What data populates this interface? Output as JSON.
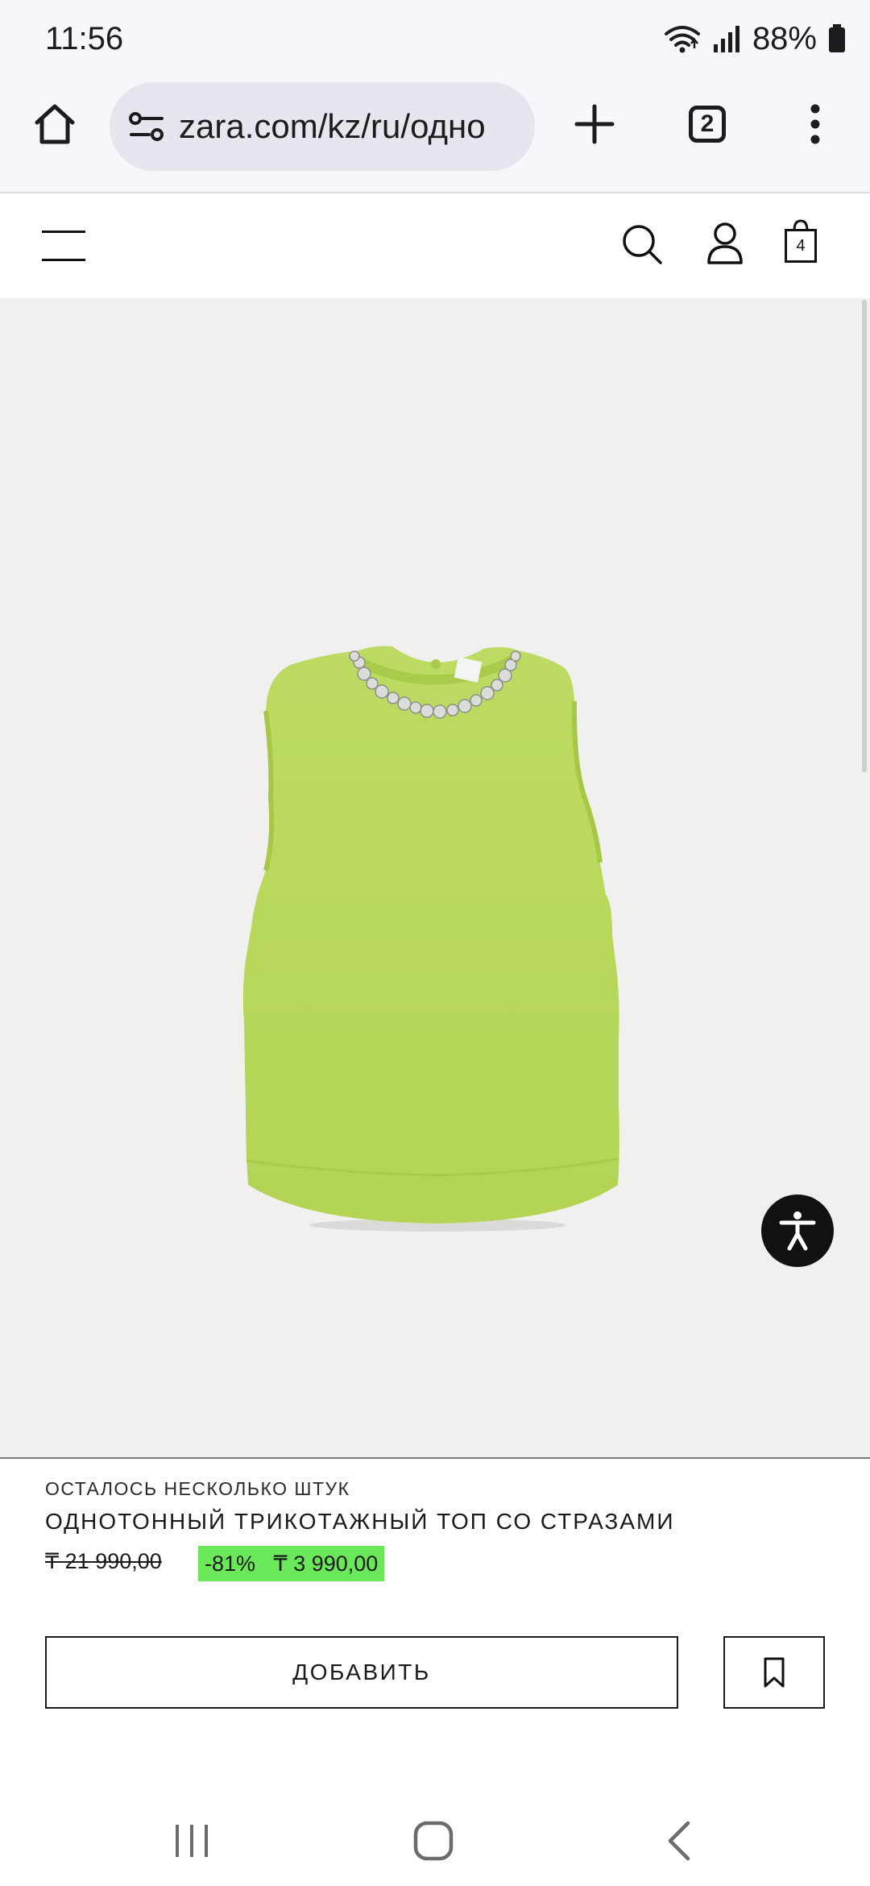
{
  "status_bar": {
    "time": "11:56",
    "battery_percent": "88%",
    "icons": [
      "wifi-icon",
      "signal-icon",
      "battery-icon"
    ]
  },
  "browser": {
    "url": "zara.com/kz/ru/одно",
    "tab_count": "2",
    "icons": [
      "home-icon",
      "site-settings-icon",
      "plus-icon",
      "tabs-icon",
      "more-vert-icon"
    ]
  },
  "site_header": {
    "bag_count": "4",
    "icons": [
      "hamburger-menu-icon",
      "search-icon",
      "account-icon",
      "shopping-bag-icon"
    ]
  },
  "product": {
    "image_subject": "lime sleeveless knit top",
    "stock_note": "ОСТАЛОСЬ НЕСКОЛЬКО ШТУК",
    "title": "ОДНОТОННЫЙ ТРИКОТАЖНЫЙ ТОП СО СТРАЗАМИ",
    "old_price": "₸ 21 990,00",
    "discount": "-81%",
    "new_price": "₸ 3 990,00",
    "sale_color": "#6be85a",
    "garment_color": "#b9d95a"
  },
  "actions": {
    "add_label": "ДОБАВИТЬ",
    "bookmark_icon": "bookmark-icon",
    "accessibility_icon": "accessibility-icon"
  },
  "nav_bar": {
    "icons": [
      "recents-icon",
      "home-circle-icon",
      "back-icon"
    ]
  }
}
